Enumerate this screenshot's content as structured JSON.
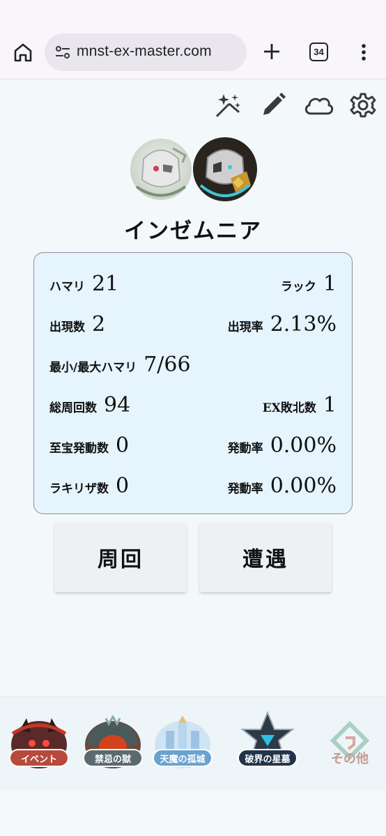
{
  "browser": {
    "url": "mnst-ex-master.com",
    "tab_count": "34"
  },
  "toolbar": {
    "icons": [
      "sparkle-icon",
      "pencil-icon",
      "cloud-icon",
      "gear-icon"
    ]
  },
  "character": {
    "name": "インゼムニア"
  },
  "stats": {
    "hamari_label": "ハマリ",
    "hamari_value": "21",
    "luck_label": "ラック",
    "luck_value": "1",
    "appear_count_label": "出現数",
    "appear_count_value": "2",
    "appear_rate_label": "出現率",
    "appear_rate_value": "2.13%",
    "minmax_label": "最小/最大ハマリ",
    "minmax_value": "7/66",
    "total_runs_label": "総周回数",
    "total_runs_value": "94",
    "ex_defeat_label": "EX敗北数",
    "ex_defeat_value": "1",
    "treasure_label": "至宝発動数",
    "treasure_value": "0",
    "treasure_rate_label": "発動率",
    "treasure_rate_value": "0.00%",
    "lakiriza_label": "ラキリザ数",
    "lakiriza_value": "0",
    "lakiriza_rate_label": "発動率",
    "lakiriza_rate_value": "0.00%"
  },
  "actions": {
    "run_label": "周回",
    "encounter_label": "遭遇"
  },
  "bottom_nav": {
    "items": [
      {
        "label": "イベント",
        "color": "#c0392b"
      },
      {
        "label": "禁忌の獄",
        "color": "#a04a1e"
      },
      {
        "label": "天魔の孤城",
        "color": "#6aa7d8"
      },
      {
        "label": "破界の星墓",
        "color": "#1f3550"
      },
      {
        "label": "その他",
        "color": "#a8c8bf"
      }
    ]
  }
}
